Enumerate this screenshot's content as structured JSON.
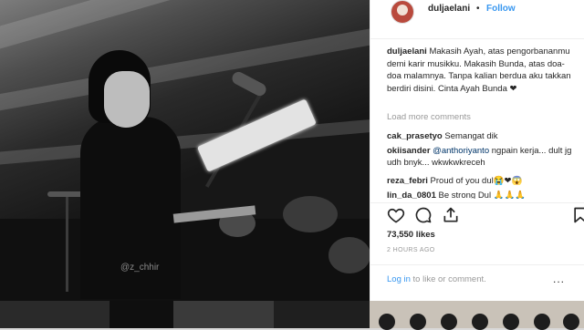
{
  "post": {
    "username": "duljaelani",
    "separator": "•",
    "follow_label": "Follow",
    "photo_watermark": "@z_chhir",
    "caption_user": "duljaelani",
    "caption_text": "Makasih Ayah, atas pengorbananmu demi karir musikku. Makasih Bunda, atas doa-doa malamnya. Tanpa kalian berdua aku takkan berdiri disini. Cinta Ayah Bunda ❤",
    "load_more": "Load more comments",
    "comments": [
      {
        "user": "cak_prasetyo",
        "text": "Semangat dik"
      },
      {
        "user": "okiisander",
        "mention": "@anthoriyanto",
        "text": "ngpain kerja... dult jg udh bnyk... wkwkwkreceh"
      },
      {
        "user": "reza_febri",
        "text": "Proud of you dul😭❤😱"
      },
      {
        "user": "lin_da_0801",
        "text": "Be strong Dul 🙏🙏🙏"
      }
    ],
    "likes": "73,550 likes",
    "time": "2 HOURS AGO",
    "login_link": "Log in",
    "login_rest": "to like or comment.",
    "more_dots": "..."
  },
  "icons": [
    "heart-icon",
    "comment-icon",
    "share-icon",
    "bookmark-icon"
  ],
  "colors": {
    "link_blue": "#3897f0",
    "text": "#262626",
    "muted": "#999999"
  }
}
